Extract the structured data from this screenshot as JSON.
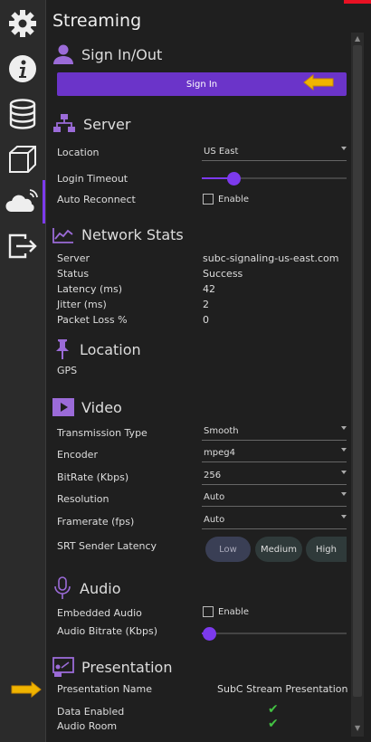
{
  "header": {
    "title": "Streaming"
  },
  "sections": {
    "sign_in": {
      "title": "Sign In/Out",
      "button": "Sign In"
    },
    "server": {
      "title": "Server",
      "location_label": "Location",
      "location_value": "US East",
      "login_timeout_label": "Login Timeout",
      "login_timeout_level": 0.22,
      "auto_reconnect_label": "Auto Reconnect",
      "enable_label": "Enable"
    },
    "network": {
      "title": "Network Stats",
      "rows": [
        {
          "label": "Server",
          "value": "subc-signaling-us-east.com"
        },
        {
          "label": "Status",
          "value": "Success"
        },
        {
          "label": "Latency (ms)",
          "value": "42"
        },
        {
          "label": "Jitter (ms)",
          "value": "2"
        },
        {
          "label": "Packet Loss %",
          "value": "0"
        }
      ]
    },
    "location": {
      "title": "Location",
      "gps": "GPS"
    },
    "video": {
      "title": "Video",
      "fields": [
        {
          "label": "Transmission Type",
          "value": "Smooth"
        },
        {
          "label": "Encoder",
          "value": "mpeg4"
        },
        {
          "label": "BitRate (Kbps)",
          "value": "256"
        },
        {
          "label": "Resolution",
          "value": "Auto"
        },
        {
          "label": "Framerate (fps)",
          "value": "Auto"
        }
      ],
      "srt_label": "SRT Sender Latency",
      "srt_options": [
        "Low",
        "Medium",
        "High"
      ],
      "srt_selected": "Low"
    },
    "audio": {
      "title": "Audio",
      "embedded_label": "Embedded Audio",
      "enable_label": "Enable",
      "bitrate_label": "Audio Bitrate (Kbps)",
      "bitrate_level": 0.05
    },
    "presentation": {
      "title": "Presentation",
      "name_label": "Presentation Name",
      "name_value": "SubC Stream Presentation",
      "data_enabled_label": "Data Enabled",
      "audio_room_label": "Audio Room",
      "data_enabled": true,
      "audio_room": true
    }
  },
  "sidebar": {
    "items": [
      {
        "icon": "gear-icon"
      },
      {
        "icon": "info-icon"
      },
      {
        "icon": "database-icon"
      },
      {
        "icon": "cube-icon"
      },
      {
        "icon": "cloud-stream-icon",
        "active": true
      },
      {
        "icon": "exit-icon"
      }
    ]
  },
  "colors": {
    "accent": "#7c3aed",
    "button": "#6b34c9",
    "arrow": "#f0b400",
    "check": "#43c243"
  }
}
